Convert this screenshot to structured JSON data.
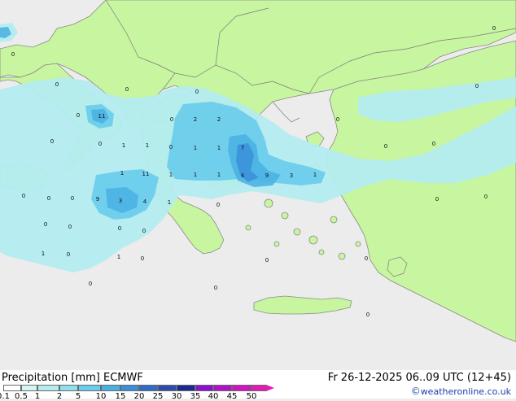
{
  "title": "Precipitation [mm] ECMWF",
  "timestamp": "Fr 26-12-2025 06..09 UTC (12+45)",
  "credit": "weatheronline.co.uk",
  "credit_symbol": "©",
  "colors": {
    "sea": "#ececec",
    "land": "#c8f5a0",
    "coast": "#888888",
    "border": "#7a7a7a"
  },
  "legend": {
    "levels": [
      "0.1",
      "0.5",
      "1",
      "2",
      "5",
      "10",
      "15",
      "20",
      "25",
      "30",
      "35",
      "40",
      "45",
      "50"
    ],
    "colors": [
      "#ffffff",
      "#d6f5f5",
      "#b4ecf0",
      "#8ee0ee",
      "#68ccec",
      "#48b0e2",
      "#3a8ed8",
      "#2e6cc8",
      "#2e4aac",
      "#1a2890",
      "#8c10d0",
      "#b012c8",
      "#d014c0",
      "#e818b8"
    ]
  },
  "precip_values": [
    "11",
    "1",
    "1",
    "2",
    "2",
    "1",
    "1",
    "7",
    "1",
    "11",
    "1",
    "1",
    "1",
    "4",
    "9",
    "3",
    "1",
    "3",
    "4",
    "9",
    "1",
    "1",
    "1",
    "0",
    "0",
    "0",
    "0",
    "0",
    "0",
    "0",
    "0",
    "0",
    "0",
    "0",
    "0",
    "0",
    "0",
    "0",
    "0",
    "0",
    "0",
    "0",
    "0",
    "0",
    "0",
    "0",
    "0",
    "0",
    "0",
    "0",
    "0",
    "0",
    "0",
    "0"
  ]
}
